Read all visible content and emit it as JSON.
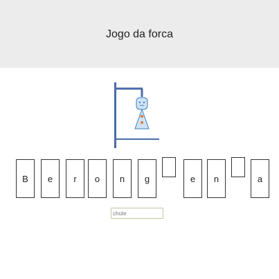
{
  "header": {
    "title": "Jogo da forca"
  },
  "gallows": {
    "color": "#4a6aa8",
    "figure_color": "#3d7fc1",
    "button_color": "#e07a3a"
  },
  "word": {
    "slots": [
      {
        "letter": "B",
        "revealed": true
      },
      {
        "letter": "e",
        "revealed": true
      },
      {
        "letter": "r",
        "revealed": true
      },
      {
        "letter": "o",
        "revealed": true
      },
      {
        "letter": "n",
        "revealed": true
      },
      {
        "letter": "g",
        "revealed": true
      },
      {
        "letter": "",
        "revealed": false
      },
      {
        "letter": "e",
        "revealed": true
      },
      {
        "letter": "n",
        "revealed": true
      },
      {
        "letter": "",
        "revealed": false
      },
      {
        "letter": "a",
        "revealed": true
      }
    ]
  },
  "guess": {
    "placeholder": "chute",
    "value": ""
  }
}
